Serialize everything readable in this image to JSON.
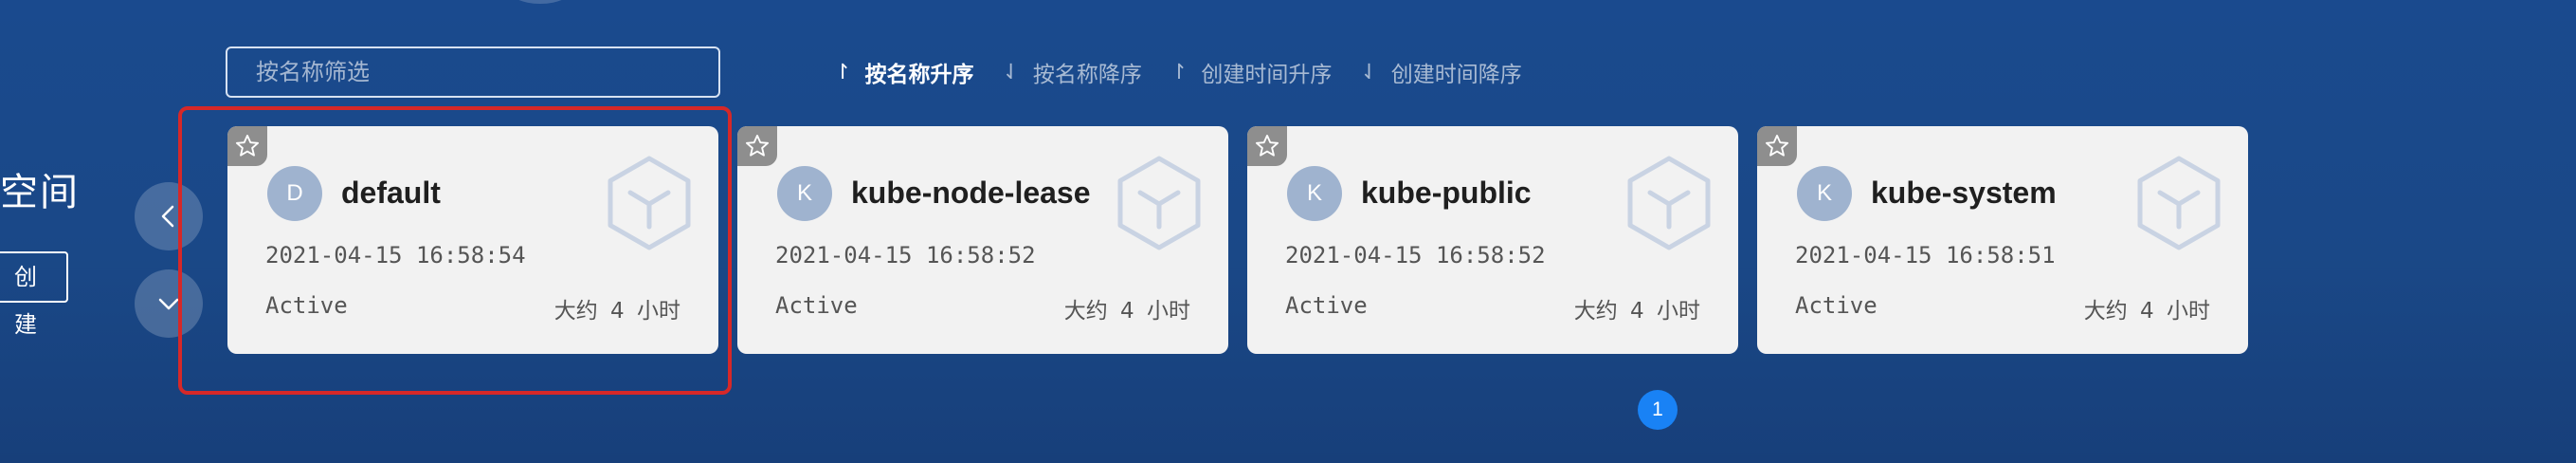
{
  "page": {
    "title_partial": "空间",
    "create_label": "创 建"
  },
  "search": {
    "placeholder": "按名称筛选",
    "value": ""
  },
  "sort": [
    {
      "label": "按名称升序",
      "arrow": "↾",
      "active": true
    },
    {
      "label": "按名称降序",
      "arrow": "⇃",
      "active": false
    },
    {
      "label": "创建时间升序",
      "arrow": "↾",
      "active": false
    },
    {
      "label": "创建时间降序",
      "arrow": "⇃",
      "active": false
    }
  ],
  "cards": [
    {
      "initial": "D",
      "name": "default",
      "created": "2021-04-15 16:58:54",
      "status": "Active",
      "age": "大约 4 小时"
    },
    {
      "initial": "K",
      "name": "kube-node-lease",
      "created": "2021-04-15 16:58:52",
      "status": "Active",
      "age": "大约 4 小时"
    },
    {
      "initial": "K",
      "name": "kube-public",
      "created": "2021-04-15 16:58:52",
      "status": "Active",
      "age": "大约 4 小时"
    },
    {
      "initial": "K",
      "name": "kube-system",
      "created": "2021-04-15 16:58:51",
      "status": "Active",
      "age": "大约 4 小时"
    }
  ],
  "pagination": {
    "current": "1"
  },
  "icons": {
    "prev": "chevron-left-icon",
    "collapse": "chevron-down-icon",
    "favorite": "star-icon",
    "namespace": "cube-icon"
  },
  "colors": {
    "background": "#1a4a8e",
    "card": "#f2f2f2",
    "avatar": "#9fb3cf",
    "highlight": "#d62828",
    "page_active": "#1982f5"
  }
}
